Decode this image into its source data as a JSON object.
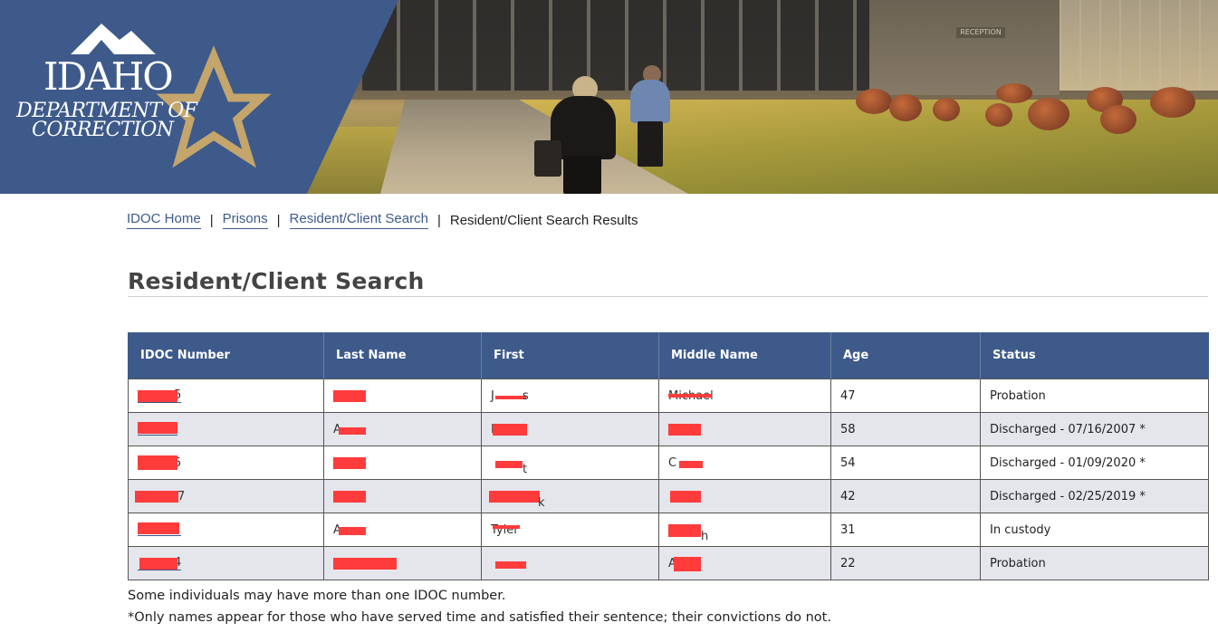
{
  "banner": {
    "logo_state": "IDAHO",
    "logo_line1": "DEPARTMENT OF",
    "logo_line2": "CORRECTION",
    "sign_text": "RECEPTION",
    "colors": {
      "panel": "#3d5a8a",
      "star": "#c4a56b"
    }
  },
  "breadcrumb": {
    "items": [
      {
        "label": "IDOC Home"
      },
      {
        "label": "Prisons"
      },
      {
        "label": "Resident/Client Search"
      }
    ],
    "current": "Resident/Client Search Results",
    "separator": "|"
  },
  "page": {
    "title": "Resident/Client Search"
  },
  "table": {
    "columns": [
      "IDOC Number",
      "Last Name",
      "First",
      "Middle Name",
      "Age",
      "Status"
    ],
    "rows": [
      {
        "idoc_visible": "5",
        "last_visible": "",
        "first_visible": "J",
        "first_tail": "s",
        "middle_visible": "Michael",
        "age": "47",
        "status": "Probation"
      },
      {
        "idoc_visible": "",
        "last_visible": "A",
        "first_visible": "M",
        "first_tail": "",
        "middle_visible": "",
        "age": "58",
        "status": "Discharged - 07/16/2007 *"
      },
      {
        "idoc_visible": "5",
        "last_visible": "",
        "first_visible": "",
        "first_tail": "t",
        "middle_visible": "C",
        "age": "54",
        "status": "Discharged - 01/09/2020 *"
      },
      {
        "idoc_visible": "7",
        "last_visible": "",
        "first_visible": "",
        "first_tail": "k",
        "middle_visible": "",
        "age": "42",
        "status": "Discharged - 02/25/2019 *"
      },
      {
        "idoc_visible": "",
        "last_visible": "A",
        "first_visible": "Tyler",
        "first_tail": "",
        "middle_visible": "h",
        "age": "31",
        "status": "In custody"
      },
      {
        "idoc_visible": "4",
        "last_visible": "",
        "first_visible": "",
        "first_tail": "",
        "middle_visible": "A",
        "age": "22",
        "status": "Probation"
      }
    ],
    "colors": {
      "header": "#3d5a8a",
      "alt_row": "#e4e6ec",
      "redaction": "#ff3b3b"
    }
  },
  "notes": {
    "line1": "Some individuals may have more than one IDOC number.",
    "line2": "*Only names appear for those who have served time and satisfied their sentence; their convictions do not."
  }
}
